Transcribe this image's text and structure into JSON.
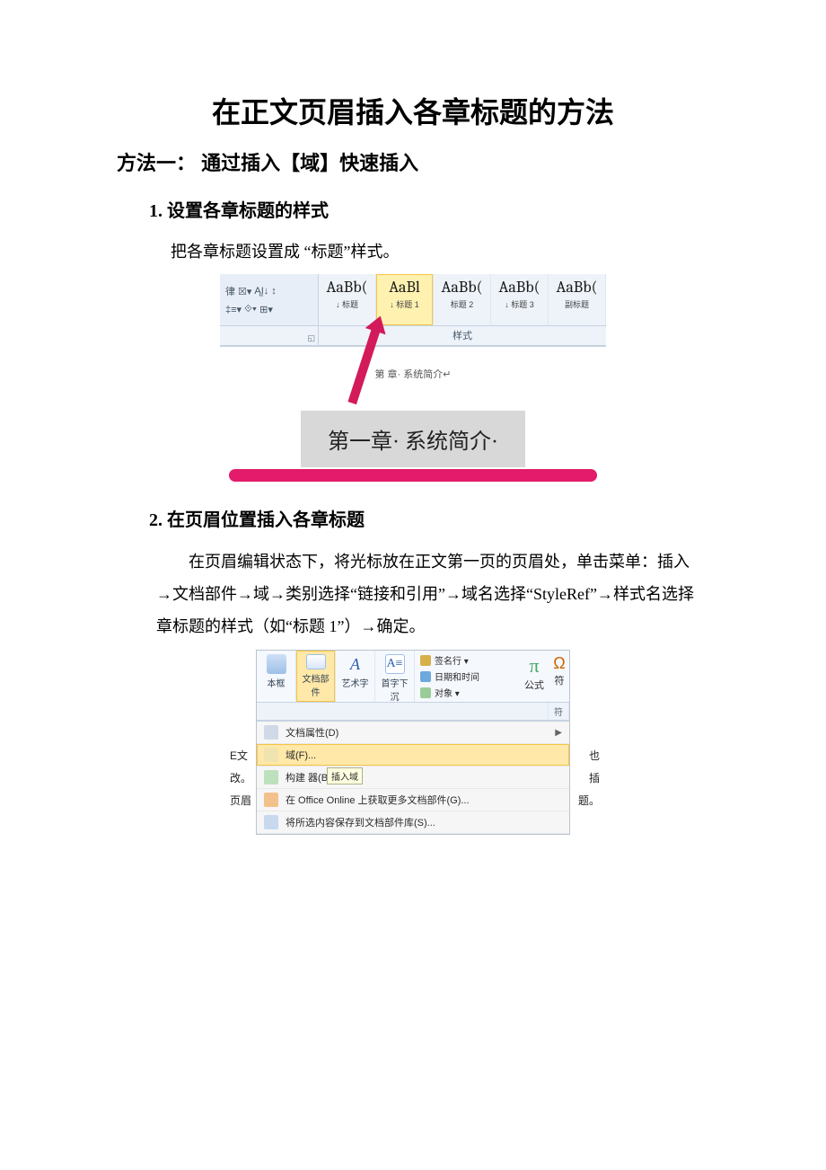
{
  "title": "在正文页眉插入各章标题的方法",
  "method1": "方法一： 通过插入【域】快速插入",
  "step1": {
    "num": "1.",
    "text": "设置各章标题的样式"
  },
  "step1_body": "把各章标题设置成 “标题”样式。",
  "fig1": {
    "styles": [
      {
        "big": "AaBb(",
        "small": "↓ 标题"
      },
      {
        "big": "AaBl",
        "small": "↓ 标题 1"
      },
      {
        "big": "AaBb(",
        "small": "标题 2"
      },
      {
        "big": "AaBb(",
        "small": "↓ 标题 3"
      },
      {
        "big": "AaBb(",
        "small": "副标题"
      }
    ],
    "group_label": "样式",
    "header_preview": "第 章· 系统简介↵",
    "callout": "第一章· 系统简介·"
  },
  "step2": {
    "num": "2.",
    "text": "在页眉位置插入各章标题"
  },
  "step2_body": "在页眉编辑状态下，将光标放在正文第一页的页眉处，单击菜单：插入→文档部件→域→类别选择“链接和引用”→域名选择“StyleRef”→样式名选择章标题的样式（如“标题 1”）→确定。",
  "fig2": {
    "ribbon": {
      "textbox": "本框",
      "quickparts": "文档部件",
      "wordart": "艺术字",
      "dropcap": "首字下沉",
      "sig": "签名行 ▾",
      "datetime": "日期和时间",
      "object": "对象 ▾",
      "equation": "公式",
      "symbol": "符"
    },
    "menu": {
      "docprops": "文档属性(D)",
      "field": "域(F)...",
      "builder": "构建 器(B)...",
      "tooltip": "插入域",
      "online": "在 Office Online 上获取更多文档部件(G)...",
      "save": "将所选内容保存到文档部件库(S)..."
    },
    "side": {
      "left1": "E文",
      "left2": "改。",
      "left3": "页眉",
      "r1": "也",
      "r2": "插",
      "r3": "题。",
      "r4": "符"
    }
  }
}
